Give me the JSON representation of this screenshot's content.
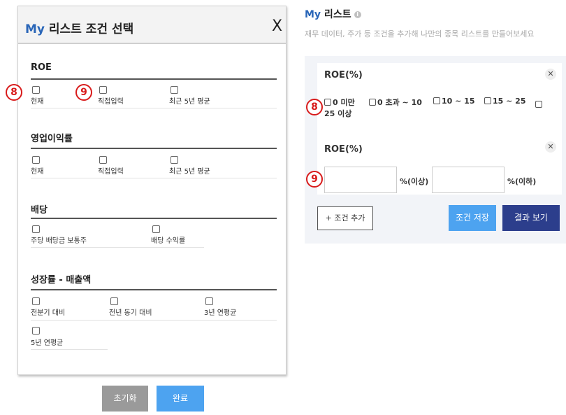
{
  "modal": {
    "title_prefix": "My",
    "title_rest": " 리스트 조건 선택",
    "close": "X",
    "sections": [
      {
        "title": "ROE",
        "options": [
          "현재",
          "직접입력",
          "최근 5년 평균"
        ]
      },
      {
        "title": "영업이익률",
        "options": [
          "현재",
          "직접입력",
          "최근 5년 평균"
        ]
      },
      {
        "title": "배당",
        "options": [
          "주당 배당금 보통주",
          "배당 수익률"
        ]
      },
      {
        "title": "성장률 - 매출액",
        "options": [
          "전분기 대비",
          "전년 동기 대비",
          "3년 연평균",
          "5년 연평균"
        ]
      }
    ],
    "reset_label": "초기화",
    "done_label": "완료"
  },
  "badges": {
    "eight": "8",
    "nine": "9"
  },
  "panel": {
    "title_prefix": "My",
    "title_rest": " 리스트",
    "info_icon": "i",
    "subtitle": "재무 데이터, 주가 등 조건을 추가해 나만의 종목 리스트를 만들어보세요",
    "card1": {
      "title": "ROE(%)",
      "close": "✕",
      "options": [
        "0 미만",
        "0 초과 ~ 10",
        "10 ~ 15",
        "15 ~ 25",
        "25 이상"
      ]
    },
    "card2": {
      "title": "ROE(%)",
      "close": "✕",
      "min_unit": "%(이상)",
      "max_unit": "%(이하)"
    },
    "add_label": "+ 조건 추가",
    "save_label": "조건 저장",
    "result_label": "결과 보기"
  }
}
